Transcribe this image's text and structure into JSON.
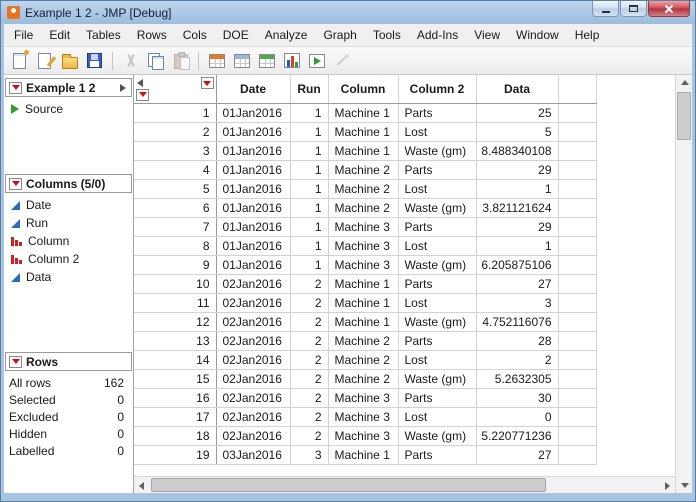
{
  "titlebar": {
    "title": "Example 1 2 - JMP [Debug]"
  },
  "menu_bar": {
    "items": [
      "File",
      "Edit",
      "Tables",
      "Rows",
      "Cols",
      "DOE",
      "Analyze",
      "Graph",
      "Tools",
      "Add-Ins",
      "View",
      "Window",
      "Help"
    ]
  },
  "toolbar": {
    "icons": [
      {
        "name": "new-data-table-icon",
        "type": "page"
      },
      {
        "name": "new-journal-icon",
        "type": "page2"
      },
      {
        "name": "open-icon",
        "type": "folder"
      },
      {
        "name": "save-icon",
        "type": "floppy"
      },
      {
        "name": "separator",
        "type": "separator"
      },
      {
        "name": "cut-icon",
        "type": "cut",
        "disabled": true
      },
      {
        "name": "copy-icon",
        "type": "copy"
      },
      {
        "name": "paste-icon",
        "type": "paste",
        "disabled": true
      },
      {
        "name": "separator",
        "type": "separator"
      },
      {
        "name": "summary-table-icon",
        "type": "table-orange"
      },
      {
        "name": "data-table-icon",
        "type": "table-plain"
      },
      {
        "name": "new-rows-table-icon",
        "type": "table-green"
      },
      {
        "name": "graph-builder-icon",
        "type": "chart"
      },
      {
        "name": "run-script-icon",
        "type": "run"
      },
      {
        "name": "format-painter-icon",
        "type": "wand",
        "disabled": true
      }
    ]
  },
  "sidebar": {
    "table_panel": {
      "title": "Example 1 2",
      "items": [
        {
          "label": "Source"
        }
      ]
    },
    "columns_panel": {
      "title": "Columns (5/0)",
      "items": [
        {
          "label": "Date",
          "role": "continuous"
        },
        {
          "label": "Run",
          "role": "continuous"
        },
        {
          "label": "Column",
          "role": "nominal"
        },
        {
          "label": "Column 2",
          "role": "nominal"
        },
        {
          "label": "Data",
          "role": "continuous"
        }
      ]
    },
    "rows_panel": {
      "title": "Rows",
      "stats": [
        {
          "label": "All rows",
          "value": "162"
        },
        {
          "label": "Selected",
          "value": "0"
        },
        {
          "label": "Excluded",
          "value": "0"
        },
        {
          "label": "Hidden",
          "value": "0"
        },
        {
          "label": "Labelled",
          "value": "0"
        }
      ]
    }
  },
  "table": {
    "columns": [
      {
        "label": "Date",
        "align": "left"
      },
      {
        "label": "Run",
        "align": "right"
      },
      {
        "label": "Column",
        "align": "left"
      },
      {
        "label": "Column 2",
        "align": "left"
      },
      {
        "label": "Data",
        "align": "right"
      }
    ],
    "rows": [
      [
        "1",
        "01Jan2016",
        "1",
        "Machine 1",
        "Parts",
        "25"
      ],
      [
        "2",
        "01Jan2016",
        "1",
        "Machine 1",
        "Lost",
        "5"
      ],
      [
        "3",
        "01Jan2016",
        "1",
        "Machine 1",
        "Waste (gm)",
        "8.488340108"
      ],
      [
        "4",
        "01Jan2016",
        "1",
        "Machine 2",
        "Parts",
        "29"
      ],
      [
        "5",
        "01Jan2016",
        "1",
        "Machine 2",
        "Lost",
        "1"
      ],
      [
        "6",
        "01Jan2016",
        "1",
        "Machine 2",
        "Waste (gm)",
        "3.821121624"
      ],
      [
        "7",
        "01Jan2016",
        "1",
        "Machine 3",
        "Parts",
        "29"
      ],
      [
        "8",
        "01Jan2016",
        "1",
        "Machine 3",
        "Lost",
        "1"
      ],
      [
        "9",
        "01Jan2016",
        "1",
        "Machine 3",
        "Waste (gm)",
        "6.205875106"
      ],
      [
        "10",
        "02Jan2016",
        "2",
        "Machine 1",
        "Parts",
        "27"
      ],
      [
        "11",
        "02Jan2016",
        "2",
        "Machine 1",
        "Lost",
        "3"
      ],
      [
        "12",
        "02Jan2016",
        "2",
        "Machine 1",
        "Waste (gm)",
        "4.752116076"
      ],
      [
        "13",
        "02Jan2016",
        "2",
        "Machine 2",
        "Parts",
        "28"
      ],
      [
        "14",
        "02Jan2016",
        "2",
        "Machine 2",
        "Lost",
        "2"
      ],
      [
        "15",
        "02Jan2016",
        "2",
        "Machine 2",
        "Waste (gm)",
        "5.2632305"
      ],
      [
        "16",
        "02Jan2016",
        "2",
        "Machine 3",
        "Parts",
        "30"
      ],
      [
        "17",
        "02Jan2016",
        "2",
        "Machine 3",
        "Lost",
        "0"
      ],
      [
        "18",
        "02Jan2016",
        "2",
        "Machine 3",
        "Waste (gm)",
        "5.220771236"
      ],
      [
        "19",
        "03Jan2016",
        "3",
        "Machine 1",
        "Parts",
        "27"
      ]
    ]
  },
  "colors": {
    "titlebar_top": "#bdd6ee",
    "titlebar_bottom": "#9dbbdc",
    "window_border": "#a9c4e0",
    "window_border_edge": "#5a7da6",
    "close_button": "#cf4a4a",
    "red_triangle": "#cc1111",
    "continuous_blue": "#2b6cb8",
    "nominal_red": "#cc2222",
    "source_green": "#2e9e2e",
    "grid_line": "#d2d2d2",
    "header_line": "#9a9a9a",
    "menubar_bg": "#f0f0f0",
    "toolbar_bg": "#ececec"
  }
}
